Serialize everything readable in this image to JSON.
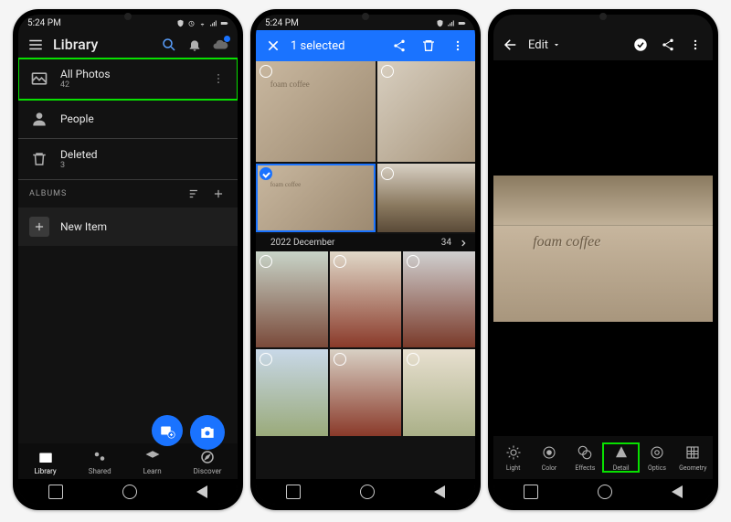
{
  "status": {
    "time": "5:24 PM"
  },
  "phone1": {
    "title": "Library",
    "rows": {
      "all": {
        "label": "All Photos",
        "count": "42"
      },
      "people": {
        "label": "People"
      },
      "deleted": {
        "label": "Deleted",
        "count": "3"
      }
    },
    "section": "ALBUMS",
    "newItem": "New Item",
    "nav": {
      "library": "Library",
      "shared": "Shared",
      "learn": "Learn",
      "discover": "Discover"
    }
  },
  "phone2": {
    "title": "1 selected",
    "groupDate": "2022 December",
    "groupCount": "34"
  },
  "phone3": {
    "title": "Edit",
    "photoText": "foam coffee",
    "tools": {
      "light": "Light",
      "color": "Color",
      "effects": "Effects",
      "detail": "Detail",
      "optics": "Optics",
      "geometry": "Geometry"
    }
  }
}
